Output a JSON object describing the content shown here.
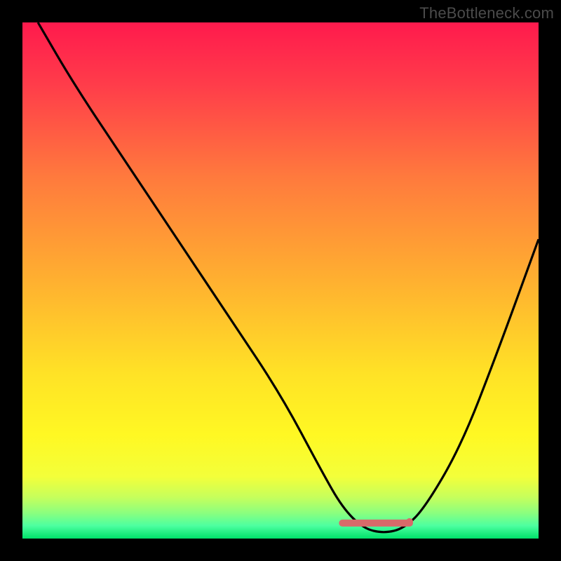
{
  "watermark": "TheBottleneck.com",
  "chart_data": {
    "type": "line",
    "title": "",
    "xlabel": "",
    "ylabel": "",
    "xlim": [
      0,
      100
    ],
    "ylim": [
      0,
      100
    ],
    "grid": false,
    "legend": false,
    "series": [
      {
        "name": "bottleneck-curve",
        "x": [
          3,
          10,
          20,
          30,
          40,
          50,
          58,
          62,
          66,
          70,
          74,
          78,
          85,
          92,
          100
        ],
        "y": [
          100,
          88,
          73,
          58,
          43,
          28,
          13,
          6,
          2,
          1,
          2,
          6,
          18,
          36,
          58
        ]
      }
    ],
    "annotations": [
      {
        "name": "optimal-range-marker",
        "type": "segment",
        "x0": 62,
        "x1": 75,
        "y": 3,
        "color": "#d86a6a",
        "width": 10
      }
    ],
    "background_gradient": {
      "stops": [
        {
          "offset": 0.0,
          "color": "#ff1a4d"
        },
        {
          "offset": 0.12,
          "color": "#ff3c4a"
        },
        {
          "offset": 0.3,
          "color": "#ff7a3d"
        },
        {
          "offset": 0.5,
          "color": "#ffb030"
        },
        {
          "offset": 0.68,
          "color": "#ffe226"
        },
        {
          "offset": 0.8,
          "color": "#fff823"
        },
        {
          "offset": 0.88,
          "color": "#f3ff3a"
        },
        {
          "offset": 0.92,
          "color": "#c6ff5c"
        },
        {
          "offset": 0.95,
          "color": "#8cff7e"
        },
        {
          "offset": 0.975,
          "color": "#4dffa0"
        },
        {
          "offset": 1.0,
          "color": "#00e26a"
        }
      ]
    }
  }
}
